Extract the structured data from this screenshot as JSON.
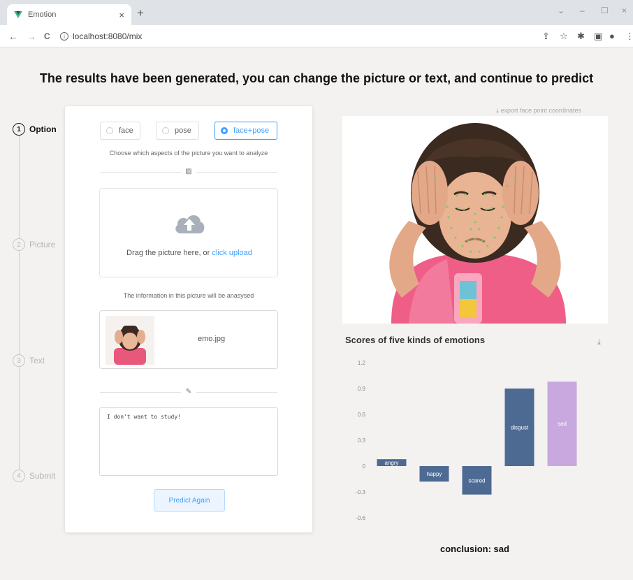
{
  "browser": {
    "tab_title": "Emotion",
    "tab_close": "×",
    "new_tab": "+",
    "url": "localhost:8080/mix",
    "nav": {
      "back": "←",
      "forward": "→",
      "reload": "C"
    },
    "window": {
      "minimize": "–",
      "restore": "☐",
      "close": "×",
      "chevron": "⌄"
    }
  },
  "heading": "The results have been generated, you can change the picture or text, and continue to predict",
  "steps": [
    {
      "num": "1",
      "label": "Option"
    },
    {
      "num": "2",
      "label": "Picture"
    },
    {
      "num": "3",
      "label": "Text"
    },
    {
      "num": "4",
      "label": "Submit"
    }
  ],
  "options": {
    "items": [
      "face",
      "pose",
      "face+pose"
    ],
    "selected": "face+pose",
    "caption": "Choose which aspects of the picture you want to analyze"
  },
  "upload": {
    "text": "Drag the picture here, or ",
    "link": "click upload",
    "caption": "The information in this picture will be anasysed"
  },
  "file": {
    "name": "emo.jpg"
  },
  "text_input": {
    "value": "I don't want to study!"
  },
  "predict_button": "Predict Again",
  "export_link": "export face point coordinates",
  "chart_data": {
    "type": "bar",
    "title": "Scores of five kinds of emotions",
    "categories": [
      "angry",
      "happy",
      "scared",
      "disgust",
      "sad"
    ],
    "values": [
      0.08,
      -0.18,
      -0.33,
      0.9,
      0.98
    ],
    "colors": [
      "#4d6a92",
      "#4d6a92",
      "#4d6a92",
      "#4d6a92",
      "#c8a8df"
    ],
    "yticks": [
      1.2,
      0.9,
      0.6,
      0.3,
      0,
      -0.3,
      -0.6
    ],
    "ylim": [
      -0.6,
      1.2
    ],
    "grid": false
  },
  "conclusion": "conclusion: sad"
}
